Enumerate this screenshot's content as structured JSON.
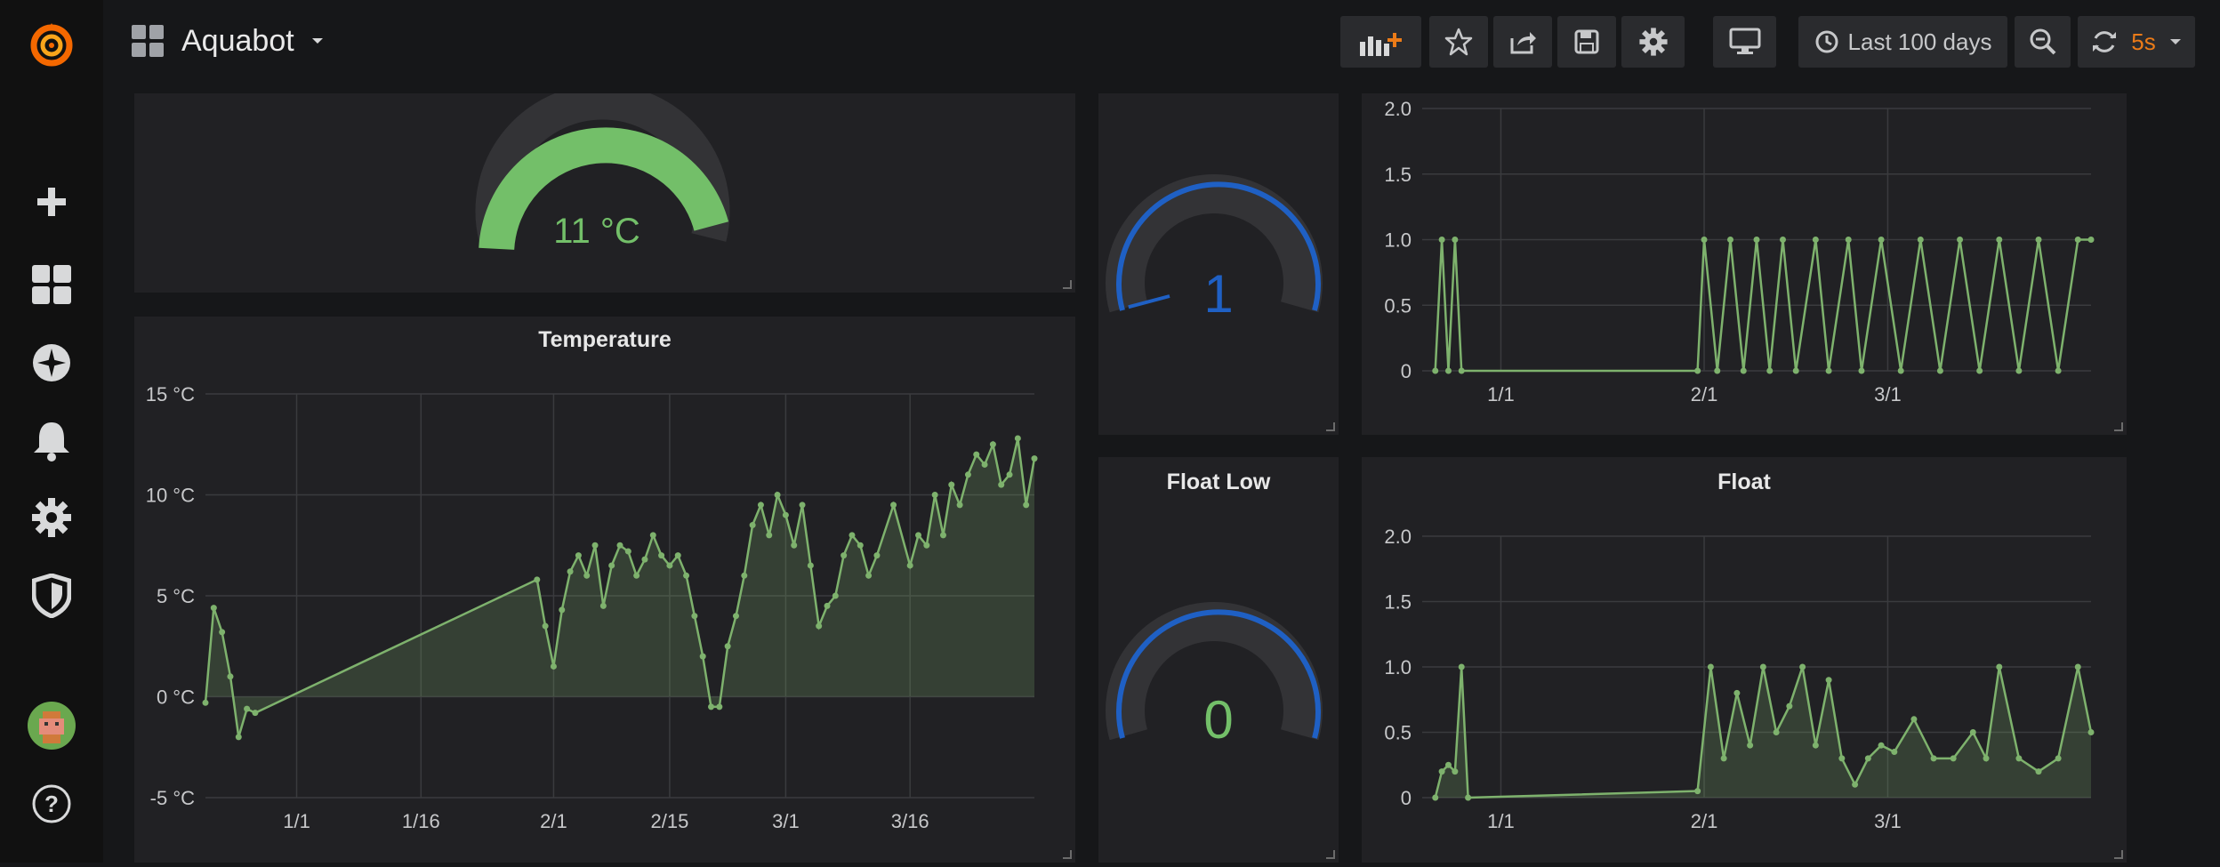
{
  "app": {
    "title": "Aquabot"
  },
  "toolbar": {
    "time_range_label": "Last 100 days",
    "refresh_interval": "5s"
  },
  "panels": {
    "temp_gauge": {
      "value_text": "11 °C",
      "value": 11,
      "min": -5,
      "max": 15,
      "color": "#73bf69"
    },
    "temperature": {
      "title": "Temperature"
    },
    "float_high_gauge": {
      "value_text": "1",
      "value": 1,
      "color": "#1f60c4"
    },
    "float_high_graph": {},
    "float_low_gauge": {
      "title": "Float Low",
      "value_text": "0",
      "value": 0,
      "color": "#73bf69"
    },
    "float_graph": {
      "title": "Float"
    }
  },
  "colors": {
    "series": "#7eb26d",
    "gauge_blue": "#1f60c4",
    "gauge_green": "#73bf69",
    "gauge_yellow": "#fade2a",
    "gauge_red": "#f2495c",
    "accent_orange": "#eb7b18"
  },
  "chart_data": [
    {
      "type": "area",
      "title": "Temperature",
      "y_ticks": [
        "15 °C",
        "10 °C",
        "5 °C",
        "0 °C",
        "-5 °C"
      ],
      "x_ticks": [
        "1/1",
        "1/16",
        "2/1",
        "2/15",
        "3/1",
        "3/16"
      ],
      "ylim": [
        -5,
        15
      ],
      "xlim": [
        "2018-12-21",
        "2019-03-31"
      ],
      "grid": true,
      "series": [
        {
          "x": [
            "2018-12-21",
            "2018-12-22",
            "2018-12-23",
            "2018-12-24",
            "2018-12-25",
            "2018-12-26",
            "2018-12-27",
            "2019-01-30",
            "2019-01-31",
            "2019-02-01",
            "2019-02-02",
            "2019-02-03",
            "2019-02-04",
            "2019-02-05",
            "2019-02-06",
            "2019-02-07",
            "2019-02-08",
            "2019-02-09",
            "2019-02-10",
            "2019-02-11",
            "2019-02-12",
            "2019-02-13",
            "2019-02-14",
            "2019-02-15",
            "2019-02-16",
            "2019-02-17",
            "2019-02-18",
            "2019-02-19",
            "2019-02-20",
            "2019-02-21",
            "2019-02-22",
            "2019-02-23",
            "2019-02-24",
            "2019-02-25",
            "2019-02-26",
            "2019-02-27",
            "2019-02-28",
            "2019-03-01",
            "2019-03-02",
            "2019-03-03",
            "2019-03-04",
            "2019-03-05",
            "2019-03-06",
            "2019-03-07",
            "2019-03-08",
            "2019-03-09",
            "2019-03-10",
            "2019-03-11",
            "2019-03-12",
            "2019-03-14",
            "2019-03-16",
            "2019-03-17",
            "2019-03-18",
            "2019-03-19",
            "2019-03-20",
            "2019-03-21",
            "2019-03-22",
            "2019-03-23",
            "2019-03-24",
            "2019-03-25",
            "2019-03-26",
            "2019-03-27",
            "2019-03-28",
            "2019-03-29",
            "2019-03-30",
            "2019-03-31"
          ],
          "y": [
            -0.3,
            4.4,
            3.2,
            1.0,
            -2.0,
            -0.6,
            -0.8,
            5.8,
            3.5,
            1.5,
            4.3,
            6.2,
            7.0,
            6.0,
            7.5,
            4.5,
            6.5,
            7.5,
            7.2,
            6.0,
            6.8,
            8.0,
            7.0,
            6.5,
            7.0,
            6.0,
            4.0,
            2.0,
            -0.5,
            -0.5,
            2.5,
            4.0,
            6.0,
            8.5,
            9.5,
            8.0,
            10.0,
            9.0,
            7.5,
            9.5,
            6.5,
            3.5,
            4.5,
            5.0,
            7.0,
            8.0,
            7.5,
            6.0,
            7.0,
            9.5,
            6.5,
            8.0,
            7.5,
            10.0,
            8.0,
            10.5,
            9.5,
            11.0,
            12.0,
            11.5,
            12.5,
            10.5,
            11.0,
            12.8,
            9.5,
            11.8
          ]
        }
      ]
    },
    {
      "type": "line",
      "y_ticks": [
        "2.0",
        "1.5",
        "1.0",
        "0.5",
        "0"
      ],
      "x_ticks": [
        "1/1",
        "2/1",
        "3/1"
      ],
      "ylim": [
        0,
        2
      ],
      "grid": true,
      "series": [
        {
          "x": [
            "2018-12-22",
            "2018-12-23",
            "2018-12-24",
            "2018-12-25",
            "2018-12-26",
            "2019-01-31",
            "2019-02-01",
            "2019-02-03",
            "2019-02-05",
            "2019-02-07",
            "2019-02-09",
            "2019-02-11",
            "2019-02-13",
            "2019-02-15",
            "2019-02-18",
            "2019-02-20",
            "2019-02-23",
            "2019-02-25",
            "2019-02-28",
            "2019-03-03",
            "2019-03-06",
            "2019-03-09",
            "2019-03-12",
            "2019-03-15",
            "2019-03-18",
            "2019-03-21",
            "2019-03-24",
            "2019-03-27",
            "2019-03-30",
            "2019-04-01"
          ],
          "y": [
            0,
            1,
            0,
            1,
            0,
            0,
            1,
            0,
            1,
            0,
            1,
            0,
            1,
            0,
            1,
            0,
            1,
            0,
            1,
            0,
            1,
            0,
            1,
            0,
            1,
            0,
            1,
            0,
            1,
            1
          ]
        }
      ]
    },
    {
      "type": "line",
      "title": "Float",
      "y_ticks": [
        "2.0",
        "1.5",
        "1.0",
        "0.5",
        "0"
      ],
      "x_ticks": [
        "1/1",
        "2/1",
        "3/1"
      ],
      "ylim": [
        0,
        2
      ],
      "grid": true,
      "series": [
        {
          "x": [
            "2018-12-22",
            "2018-12-23",
            "2018-12-24",
            "2018-12-25",
            "2018-12-26",
            "2018-12-27",
            "2019-01-31",
            "2019-02-02",
            "2019-02-04",
            "2019-02-06",
            "2019-02-08",
            "2019-02-10",
            "2019-02-12",
            "2019-02-14",
            "2019-02-16",
            "2019-02-18",
            "2019-02-20",
            "2019-02-22",
            "2019-02-24",
            "2019-02-26",
            "2019-02-28",
            "2019-03-02",
            "2019-03-05",
            "2019-03-08",
            "2019-03-11",
            "2019-03-14",
            "2019-03-16",
            "2019-03-18",
            "2019-03-21",
            "2019-03-24",
            "2019-03-27",
            "2019-03-30",
            "2019-04-01"
          ],
          "y": [
            0,
            0.2,
            0.25,
            0.2,
            1.0,
            0,
            0.05,
            1.0,
            0.3,
            0.8,
            0.4,
            1.0,
            0.5,
            0.7,
            1.0,
            0.4,
            0.9,
            0.3,
            0.1,
            0.3,
            0.4,
            0.35,
            0.6,
            0.3,
            0.3,
            0.5,
            0.3,
            1.0,
            0.3,
            0.2,
            0.3,
            1.0,
            0.5
          ]
        }
      ]
    }
  ]
}
